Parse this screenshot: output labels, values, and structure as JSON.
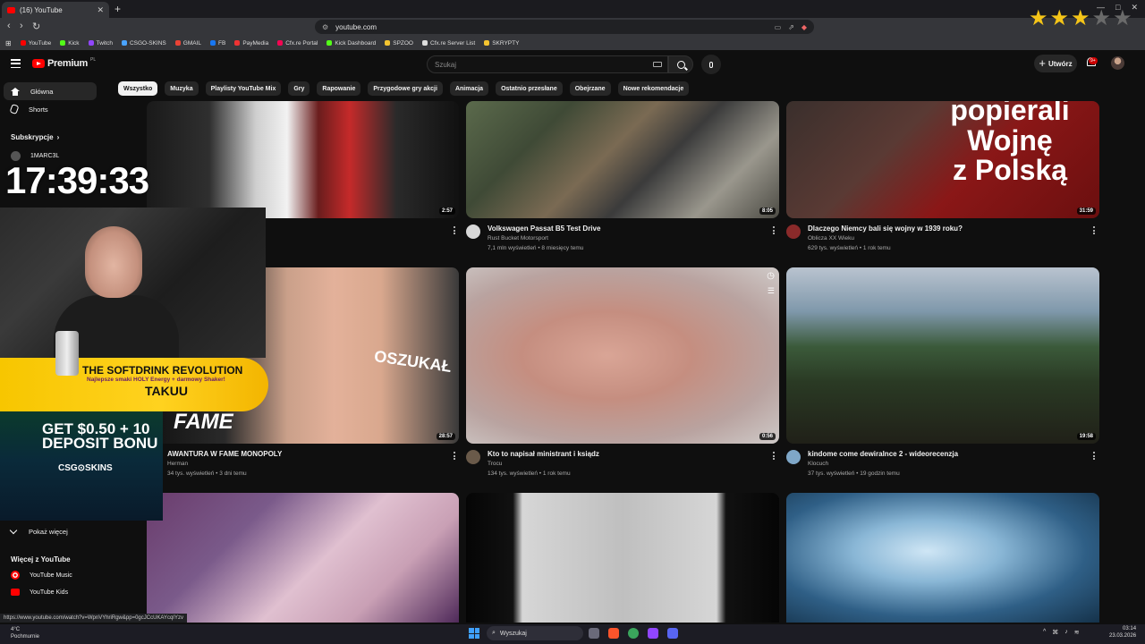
{
  "browser": {
    "tab_title": "(16) YouTube",
    "url": "youtube.com",
    "bookmarks": [
      "YouTube",
      "Kick",
      "Twitch",
      "CSGO-SKINS",
      "GMAIL",
      "FB",
      "PayMedia",
      "Cfx.re Portal",
      "Kick Dashboard",
      "SPZOO",
      "Cfx.re Server List",
      "SKRYPTY"
    ],
    "status_url": "https://www.youtube.com/watch?v=WpnVYhriRgw&pp=0gcJCcUKAYcqIYzv"
  },
  "header": {
    "logo": "Premium",
    "region": "PL",
    "search_placeholder": "Szukaj",
    "create_label": "Utwórz",
    "notif_count": "9+"
  },
  "sidebar": {
    "home": "Główna",
    "shorts": "Shorts",
    "subs_heading": "Subskrypcje",
    "sub_channel": "1MARC3L",
    "show_more": "Pokaż więcej",
    "more_heading": "Więcej z YouTube",
    "yt_music": "YouTube Music",
    "yt_kids": "YouTube Kids"
  },
  "chips": [
    "Wszystko",
    "Muzyka",
    "Gry",
    "Playlisty YouTube Mix",
    "Rapowanie",
    "Przygodowe gry akcji",
    "Animacja",
    "Ostatnio przesłane",
    "Obejrzane",
    "Nowe rekomendacje"
  ],
  "videos": {
    "v1": {
      "duration": "2:57"
    },
    "v2": {
      "title": "Volkswagen Passat B5 Test Drive",
      "channel": "Rust Bucket Motorsport",
      "meta": "7,1 mln wyświetleń • 8 miesięcy temu",
      "duration": "8:05"
    },
    "v3": {
      "title": "Dlaczego Niemcy bali się wojny w 1939 roku?",
      "channel": "Oblicza XX Wieku",
      "meta": "629 tys. wyświetleń • 1 rok temu",
      "duration": "31:59",
      "thumb_text": "popierali\nWojnę\nz Polską"
    },
    "v4": {
      "title": "AWANTURA W FAME MONOPOLY",
      "channel": "Herman",
      "meta": "34 tys. wyświetleń • 3 dni temu",
      "duration": "28:57",
      "thumb_text": "OSZUKAŁ",
      "thumb_text2": "FAME"
    },
    "v5": {
      "title": "Kto to napisał ministrant i ksiądz",
      "channel": "Trocu",
      "meta": "134 tys. wyświetleń • 1 rok temu",
      "duration": "0:56"
    },
    "v6": {
      "title": "kindome come dewiralnce 2 - wideorecenzja",
      "channel": "Klocuch",
      "meta": "37 tys. wyświetleń • 19 godzin temu",
      "duration": "19:58"
    }
  },
  "overlay": {
    "clock": "17:39:33",
    "promo_title": "THE SOFTDRINK REVOLUTION",
    "promo_sub": "Najlepsze smaki HOLY Energy + darmowy Shaker!",
    "promo_brand": "TAKUU",
    "casino_line1": "GET $0.50 + 10",
    "casino_line2": "DEPOSIT BONU",
    "casino_brand": "CSG⊙SKINS"
  },
  "taskbar": {
    "temp": "4°C",
    "weather": "Pochmurnie",
    "search": "Wyszukaj",
    "time": "03:14",
    "date": "23.03.2026"
  }
}
